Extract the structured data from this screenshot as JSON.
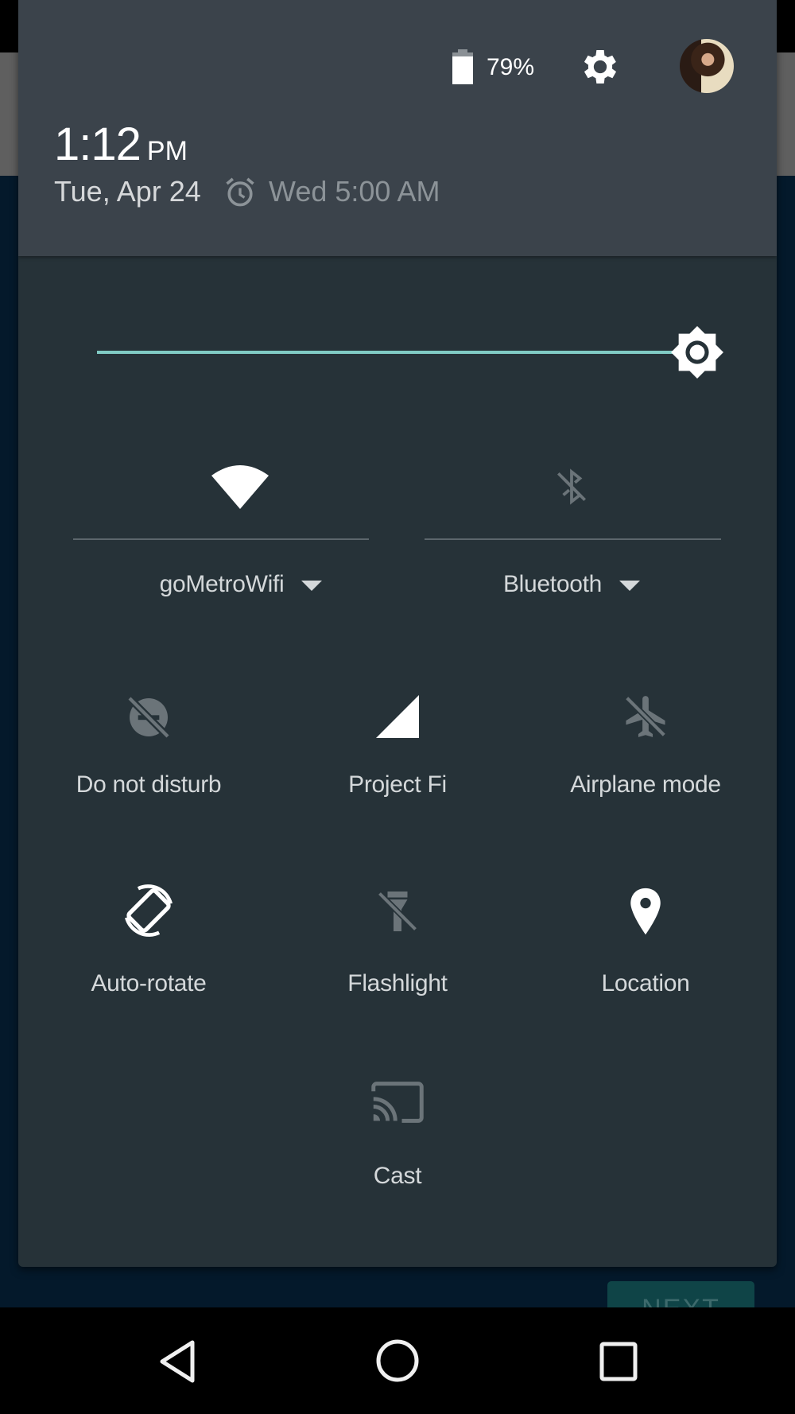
{
  "status": {
    "battery_percent": "79%",
    "battery_level": 79
  },
  "header": {
    "time": "1:12",
    "ampm": "PM",
    "date": "Tue, Apr 24",
    "alarm": "Wed 5:00 AM",
    "icons": {
      "battery": "battery-icon",
      "settings": "gear-icon",
      "avatar": "user-avatar",
      "alarm": "alarm-clock-icon"
    }
  },
  "brightness": {
    "level_percent": 100,
    "accent": "#80cbc4"
  },
  "tiles_large": [
    {
      "label": "goMetroWifi",
      "icon": "wifi-icon",
      "active": true
    },
    {
      "label": "Bluetooth",
      "icon": "bluetooth-off-icon",
      "active": false
    }
  ],
  "tiles": [
    {
      "label": "Do not disturb",
      "icon": "do-not-disturb-off-icon",
      "active": false
    },
    {
      "label": "Project Fi",
      "icon": "cell-signal-icon",
      "active": true
    },
    {
      "label": "Airplane mode",
      "icon": "airplane-off-icon",
      "active": false
    },
    {
      "label": "Auto-rotate",
      "icon": "auto-rotate-icon",
      "active": true
    },
    {
      "label": "Flashlight",
      "icon": "flashlight-off-icon",
      "active": false
    },
    {
      "label": "Location",
      "icon": "location-pin-icon",
      "active": true
    },
    {
      "label": "Cast",
      "icon": "cast-icon",
      "active": false
    }
  ],
  "background": {
    "next_button": "NEXT"
  },
  "navbar": {
    "back": "back-icon",
    "home": "home-icon",
    "recents": "recents-icon"
  },
  "colors": {
    "header": "#3b434b",
    "panel": "#263238",
    "inactive_icon": "#6b7479",
    "active_icon": "#ffffff"
  }
}
